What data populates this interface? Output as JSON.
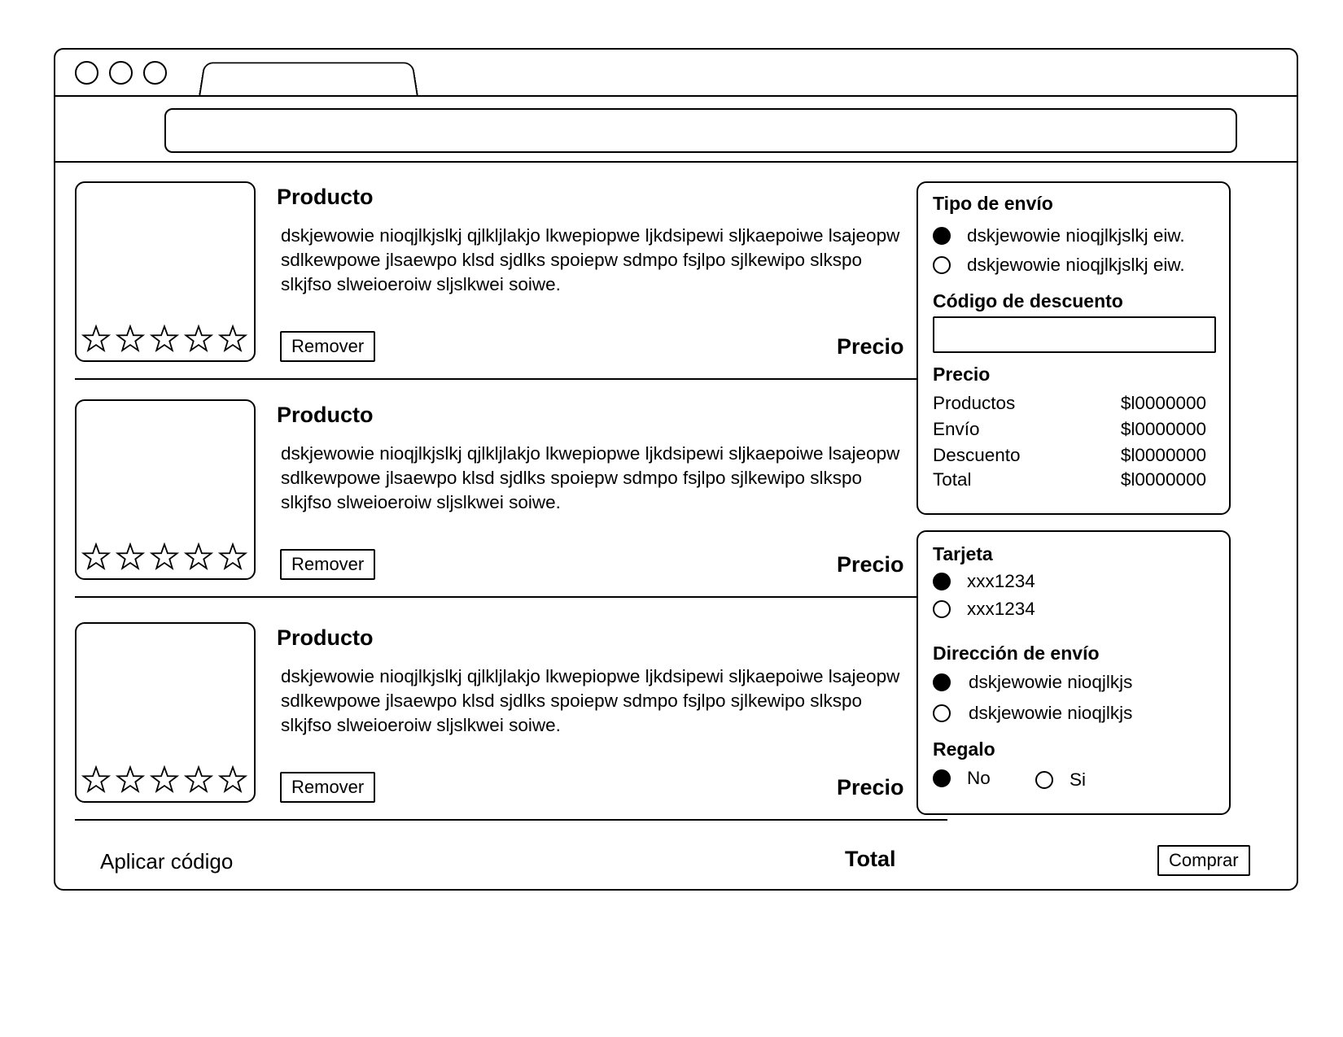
{
  "products": [
    {
      "title": "Producto",
      "description": "dskjewowie nioqjlkjslkj qjlkljlakjo lkwepiopwe ljkdsipewi sljkaepoiwe lsajeopw\nsdlkewpowe jlsaewpo klsd sjdlks spoiepw sdmpo fsjlpo sjlkewipo slkspo\nslkjfso slweioeroiw sljslkwei  soiwe.",
      "remove_label": "Remover",
      "price_label": "Precio",
      "rating_stars": 5,
      "rating_filled": 0
    },
    {
      "title": "Producto",
      "description": "dskjewowie nioqjlkjslkj qjlkljlakjo lkwepiopwe ljkdsipewi sljkaepoiwe lsajeopw\nsdlkewpowe jlsaewpo klsd sjdlks spoiepw sdmpo fsjlpo sjlkewipo slkspo\nslkjfso slweioeroiw sljslkwei  soiwe.",
      "remove_label": "Remover",
      "price_label": "Precio",
      "rating_stars": 5,
      "rating_filled": 0
    },
    {
      "title": "Producto",
      "description": "dskjewowie nioqjlkjslkj qjlkljlakjo lkwepiopwe ljkdsipewi sljkaepoiwe lsajeopw\nsdlkewpowe jlsaewpo klsd sjdlks spoiepw sdmpo fsjlpo sjlkewipo slkspo\nslkjfso slweioeroiw sljslkwei  soiwe.",
      "remove_label": "Remover",
      "price_label": "Precio",
      "rating_stars": 5,
      "rating_filled": 0
    }
  ],
  "footer": {
    "apply_code_label": "Aplicar código",
    "total_label": "Total",
    "buy_label": "Comprar"
  },
  "shipping_panel": {
    "shipping_type_heading": "Tipo de envío",
    "shipping_options": [
      {
        "label": "dskjewowie nioqjlkjslkj eiw.",
        "selected": true
      },
      {
        "label": "dskjewowie nioqjlkjslkj eiw.",
        "selected": false
      }
    ],
    "discount_heading": "Código de descuento",
    "discount_value": "",
    "price_heading": "Precio",
    "summary": [
      {
        "label": "Productos",
        "value": "$l0000000"
      },
      {
        "label": "Envío",
        "value": "$l0000000"
      },
      {
        "label": "Descuento",
        "value": "$l0000000"
      },
      {
        "label": "Total",
        "value": "$l0000000"
      }
    ]
  },
  "payment_panel": {
    "card_heading": "Tarjeta",
    "card_options": [
      {
        "label": "xxx1234",
        "selected": true
      },
      {
        "label": "xxx1234",
        "selected": false
      }
    ],
    "address_heading": "Dirección de envío",
    "address_options": [
      {
        "label": "dskjewowie nioqjlkjs",
        "selected": true
      },
      {
        "label": "dskjewowie nioqjlkjs",
        "selected": false
      }
    ],
    "gift_heading": "Regalo",
    "gift_options": [
      {
        "label": "No",
        "selected": true
      },
      {
        "label": "Si",
        "selected": false
      }
    ]
  },
  "icons": {
    "window_controls": [
      "window-control-icon",
      "window-control-icon",
      "window-control-icon"
    ],
    "rating": "star-outline-icon"
  }
}
